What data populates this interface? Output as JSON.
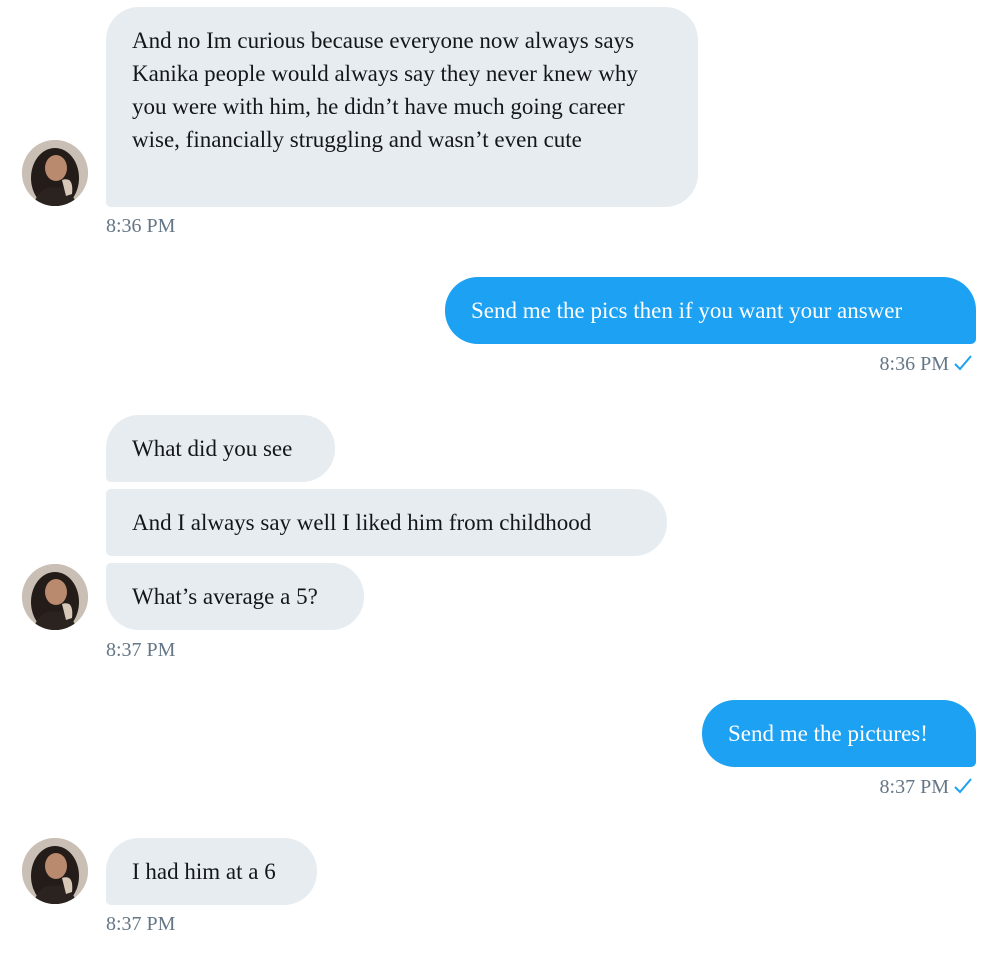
{
  "conversation": {
    "accent_color": "#1da1f2",
    "incoming_bubble_color": "#e6ecf0",
    "timestamp_color": "#657786",
    "messages": [
      {
        "direction": "incoming",
        "text": "And no Im curious because everyone now always says Kanika people would always say they never knew why you were with him, he didn’t have much going career wise, financially struggling and wasn’t even cute",
        "time": "8:36 PM"
      },
      {
        "direction": "outgoing",
        "text": "Send me the pics then if you want your answer",
        "time": "8:36 PM",
        "status_icon": "checkmark-icon"
      },
      {
        "direction": "incoming",
        "text": "What did you see"
      },
      {
        "direction": "incoming",
        "text": "And I always say well I liked him from childhood"
      },
      {
        "direction": "incoming",
        "text": "What’s average a 5?",
        "time": "8:37 PM"
      },
      {
        "direction": "outgoing",
        "text": "Send me the pictures!",
        "time": "8:37 PM",
        "status_icon": "checkmark-icon"
      },
      {
        "direction": "incoming",
        "text": "I had him at a 6",
        "time": "8:37 PM"
      }
    ]
  }
}
